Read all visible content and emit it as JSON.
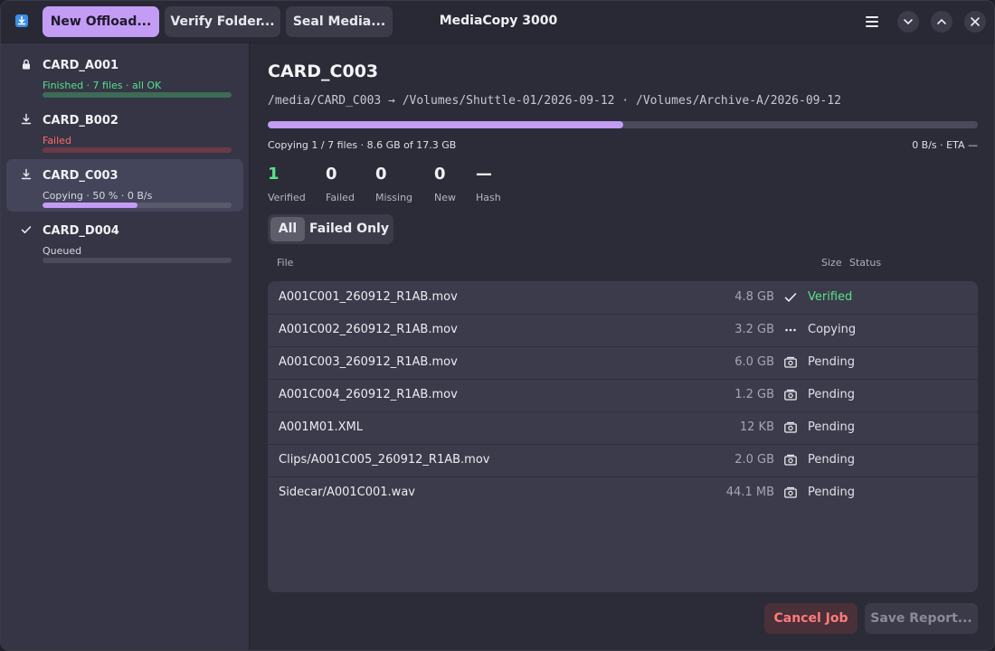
{
  "header": {
    "title": "MediaCopy 3000",
    "buttons": {
      "new_offload": "New Offload...",
      "verify_folder": "Verify Folder...",
      "seal_media": "Seal Media..."
    }
  },
  "sidebar": {
    "cards": [
      {
        "name": "CARD_A001",
        "status": "Finished · 7 files · all OK",
        "icon": "lock-icon",
        "progress": 1.0,
        "color": "#57e389"
      },
      {
        "name": "CARD_B002",
        "status": "Failed",
        "icon": "download-icon",
        "progress": 1.0,
        "color": "#ff6b6b"
      },
      {
        "name": "CARD_C003",
        "status": "Copying · 50 % · 0 B/s",
        "icon": "download-icon",
        "progress": 0.5,
        "color": "#c39cf5"
      },
      {
        "name": "CARD_D004",
        "status": "Queued",
        "icon": "check-icon",
        "progress": 0.0,
        "color": "#c39cf5"
      }
    ]
  },
  "main": {
    "title": "CARD_C003",
    "path": "/media/CARD_C003 → /Volumes/Shuttle-01/2026-09-12 · /Volumes/Archive-A/2026-09-12",
    "progress": 0.5,
    "copy_text": "Copying 1 / 7 files · 8.6 GB of 17.3 GB",
    "rate_text": "0 B/s · ETA —",
    "stats": [
      {
        "value": "1",
        "label": "Verified"
      },
      {
        "value": "0",
        "label": "Failed"
      },
      {
        "value": "0",
        "label": "Missing"
      },
      {
        "value": "0",
        "label": "New"
      },
      {
        "value": "—",
        "label": "Hash"
      }
    ],
    "filter": {
      "all": "All",
      "failed_only": "Failed Only",
      "selected": "All"
    },
    "columns": {
      "file": "File",
      "size": "Size",
      "status": "Status"
    },
    "files": [
      {
        "name": "A001C001_260912_R1AB.mov",
        "size": "4.8 GB",
        "status": "Verified",
        "icon": "check-icon"
      },
      {
        "name": "A001C002_260912_R1AB.mov",
        "size": "3.2 GB",
        "status": "Copying",
        "icon": "ellipsis-icon"
      },
      {
        "name": "A001C003_260912_R1AB.mov",
        "size": "6.0 GB",
        "status": "Pending",
        "icon": "pending-icon"
      },
      {
        "name": "A001C004_260912_R1AB.mov",
        "size": "1.2 GB",
        "status": "Pending",
        "icon": "pending-icon"
      },
      {
        "name": "A001M01.XML",
        "size": "12 KB",
        "status": "Pending",
        "icon": "pending-icon"
      },
      {
        "name": "Clips/A001C005_260912_R1AB.mov",
        "size": "2.0 GB",
        "status": "Pending",
        "icon": "pending-icon"
      },
      {
        "name": "Sidecar/A001C001.wav",
        "size": "44.1 MB",
        "status": "Pending",
        "icon": "pending-icon"
      }
    ],
    "actions": {
      "cancel": "Cancel Job",
      "save_report": "Save Report..."
    }
  }
}
